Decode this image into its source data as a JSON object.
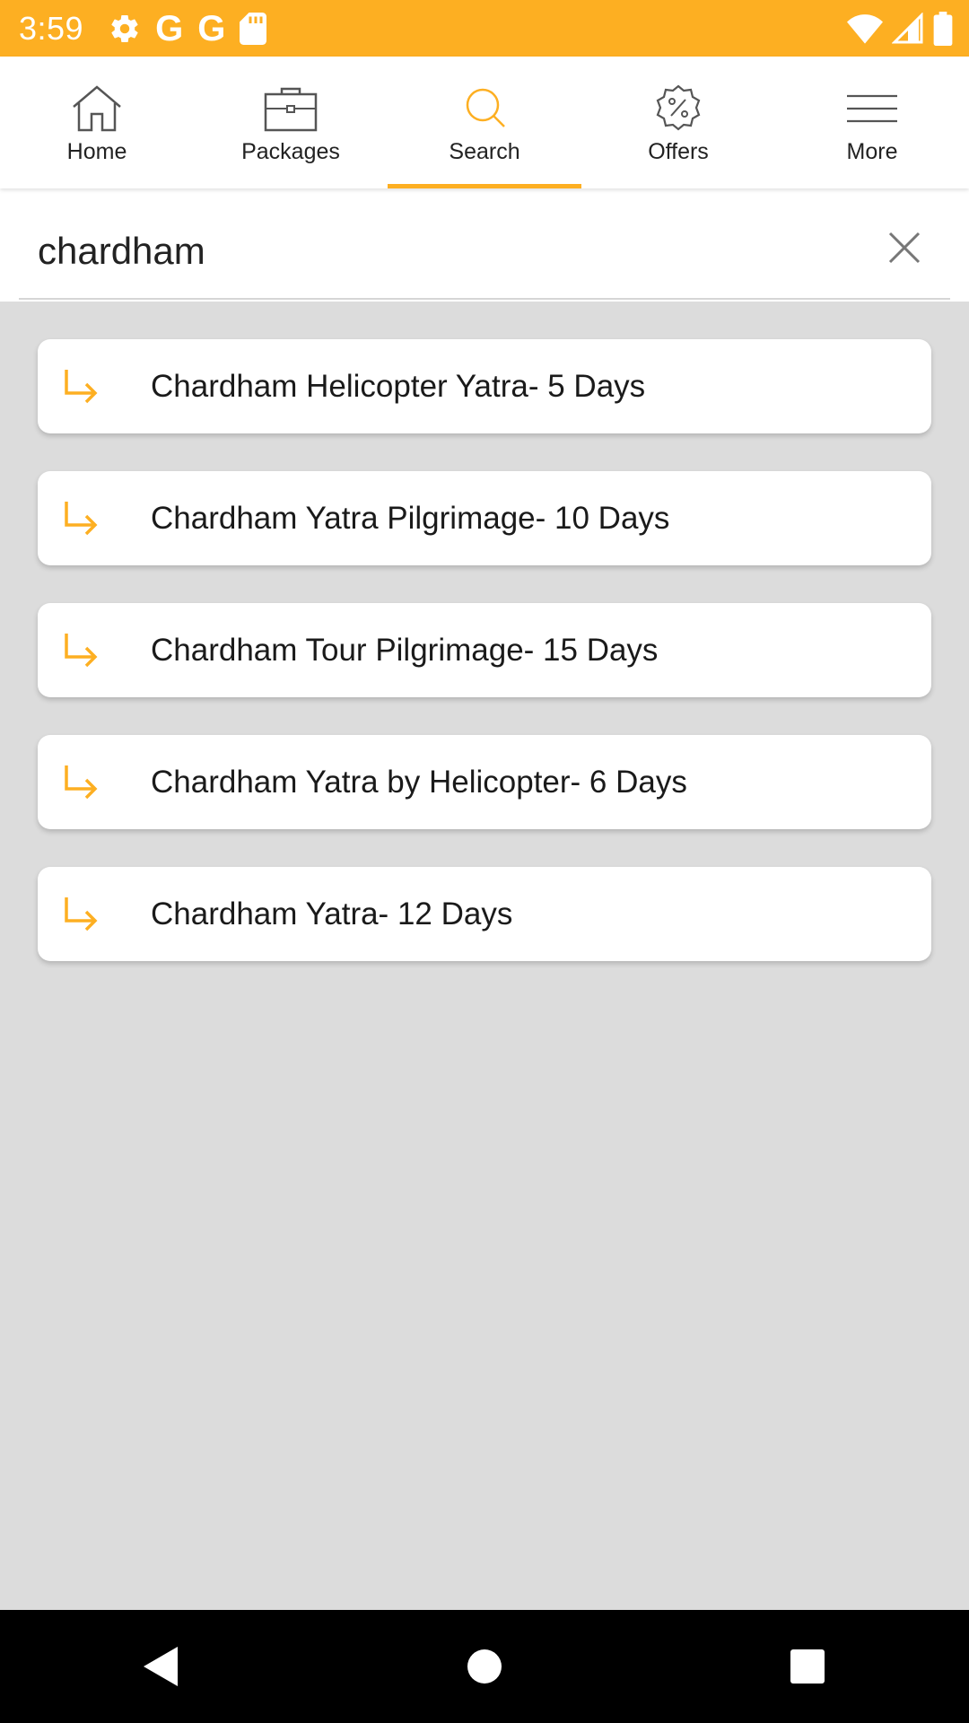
{
  "status_bar": {
    "time": "3:59",
    "left_icons": [
      "settings-gear",
      "google-g",
      "google-g",
      "sd-card"
    ],
    "right_icons": [
      "wifi",
      "cell-signal",
      "battery"
    ]
  },
  "nav": {
    "tabs": [
      {
        "label": "Home",
        "icon": "home-icon"
      },
      {
        "label": "Packages",
        "icon": "briefcase-icon"
      },
      {
        "label": "Search",
        "icon": "search-icon"
      },
      {
        "label": "Offers",
        "icon": "offers-badge-icon"
      },
      {
        "label": "More",
        "icon": "hamburger-menu-icon"
      }
    ],
    "active": "Search"
  },
  "search": {
    "value": "chardham",
    "placeholder": ""
  },
  "results": [
    {
      "label": "Chardham Helicopter Yatra- 5 Days"
    },
    {
      "label": "Chardham Yatra Pilgrimage- 10 Days"
    },
    {
      "label": "Chardham Tour Pilgrimage- 15 Days"
    },
    {
      "label": "Chardham Yatra by Helicopter- 6 Days"
    },
    {
      "label": "Chardham Yatra- 12 Days"
    }
  ],
  "colors": {
    "accent": "#fdaf22",
    "background": "#dcdcdc",
    "card": "#ffffff"
  }
}
